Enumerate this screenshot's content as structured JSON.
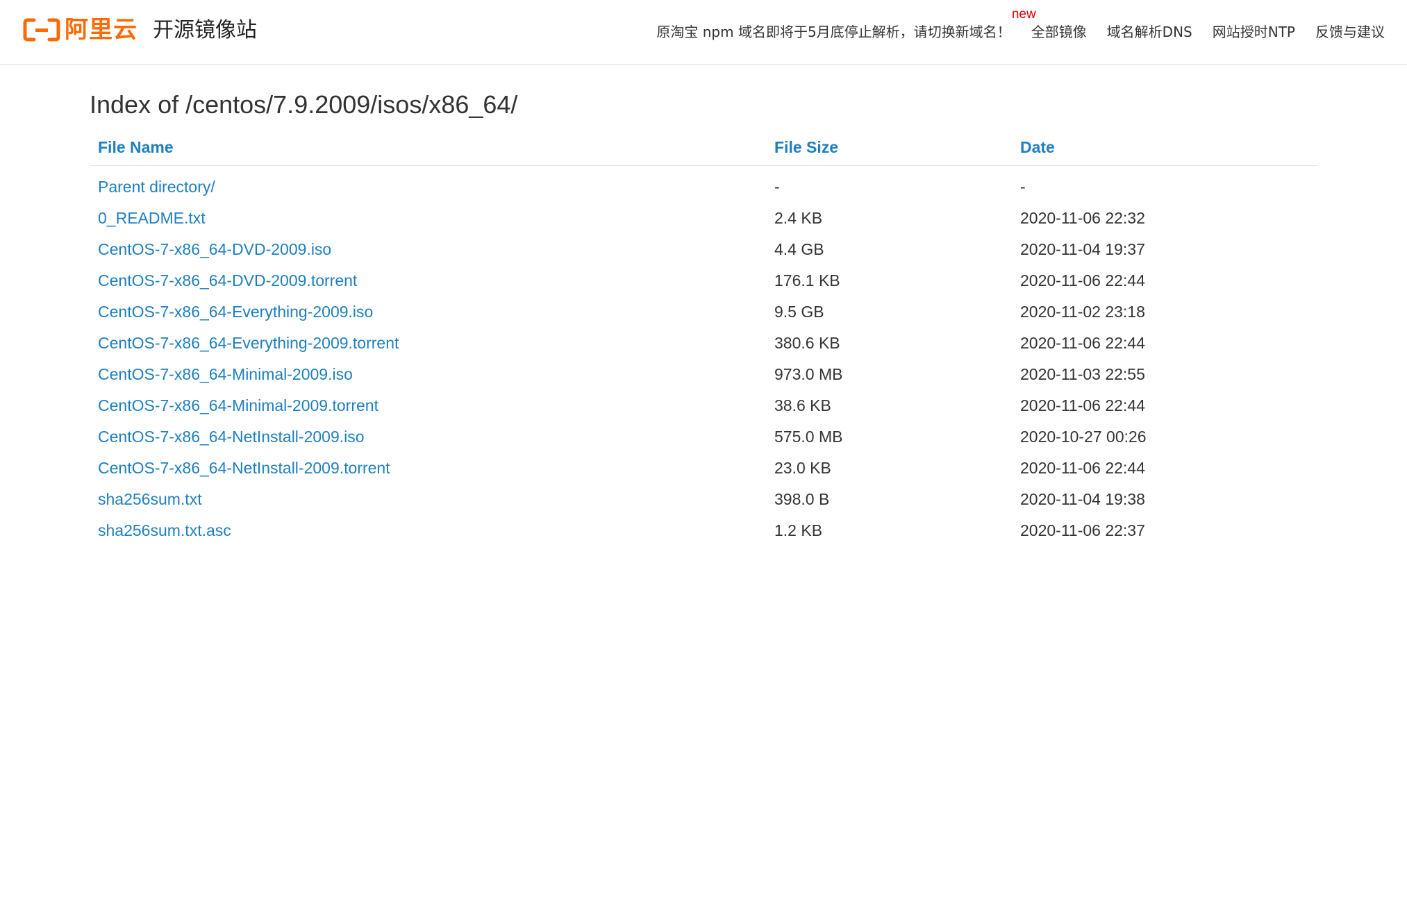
{
  "header": {
    "logo_text": "阿里云",
    "site_title": "开源镜像站",
    "nav": [
      {
        "label": "原淘宝 npm 域名即将于5月底停止解析，请切换新域名！",
        "badge": "new"
      },
      {
        "label": "全部镜像"
      },
      {
        "label": "域名解析DNS"
      },
      {
        "label": "网站授时NTP"
      },
      {
        "label": "反馈与建议"
      }
    ],
    "colors": {
      "brand": "#ff6a00",
      "badge": "#e00000"
    }
  },
  "main": {
    "title": "Index of /centos/7.9.2009/isos/x86_64/",
    "columns": {
      "name": "File Name",
      "size": "File Size",
      "date": "Date"
    },
    "link_color": "#1e7fc1",
    "rows": [
      {
        "name": "Parent directory/",
        "size": "-",
        "date": "-"
      },
      {
        "name": "0_README.txt",
        "size": "2.4 KB",
        "date": "2020-11-06 22:32"
      },
      {
        "name": "CentOS-7-x86_64-DVD-2009.iso",
        "size": "4.4 GB",
        "date": "2020-11-04 19:37"
      },
      {
        "name": "CentOS-7-x86_64-DVD-2009.torrent",
        "size": "176.1 KB",
        "date": "2020-11-06 22:44"
      },
      {
        "name": "CentOS-7-x86_64-Everything-2009.iso",
        "size": "9.5 GB",
        "date": "2020-11-02 23:18"
      },
      {
        "name": "CentOS-7-x86_64-Everything-2009.torrent",
        "size": "380.6 KB",
        "date": "2020-11-06 22:44"
      },
      {
        "name": "CentOS-7-x86_64-Minimal-2009.iso",
        "size": "973.0 MB",
        "date": "2020-11-03 22:55"
      },
      {
        "name": "CentOS-7-x86_64-Minimal-2009.torrent",
        "size": "38.6 KB",
        "date": "2020-11-06 22:44"
      },
      {
        "name": "CentOS-7-x86_64-NetInstall-2009.iso",
        "size": "575.0 MB",
        "date": "2020-10-27 00:26"
      },
      {
        "name": "CentOS-7-x86_64-NetInstall-2009.torrent",
        "size": "23.0 KB",
        "date": "2020-11-06 22:44"
      },
      {
        "name": "sha256sum.txt",
        "size": "398.0 B",
        "date": "2020-11-04 19:38"
      },
      {
        "name": "sha256sum.txt.asc",
        "size": "1.2 KB",
        "date": "2020-11-06 22:37"
      }
    ]
  }
}
